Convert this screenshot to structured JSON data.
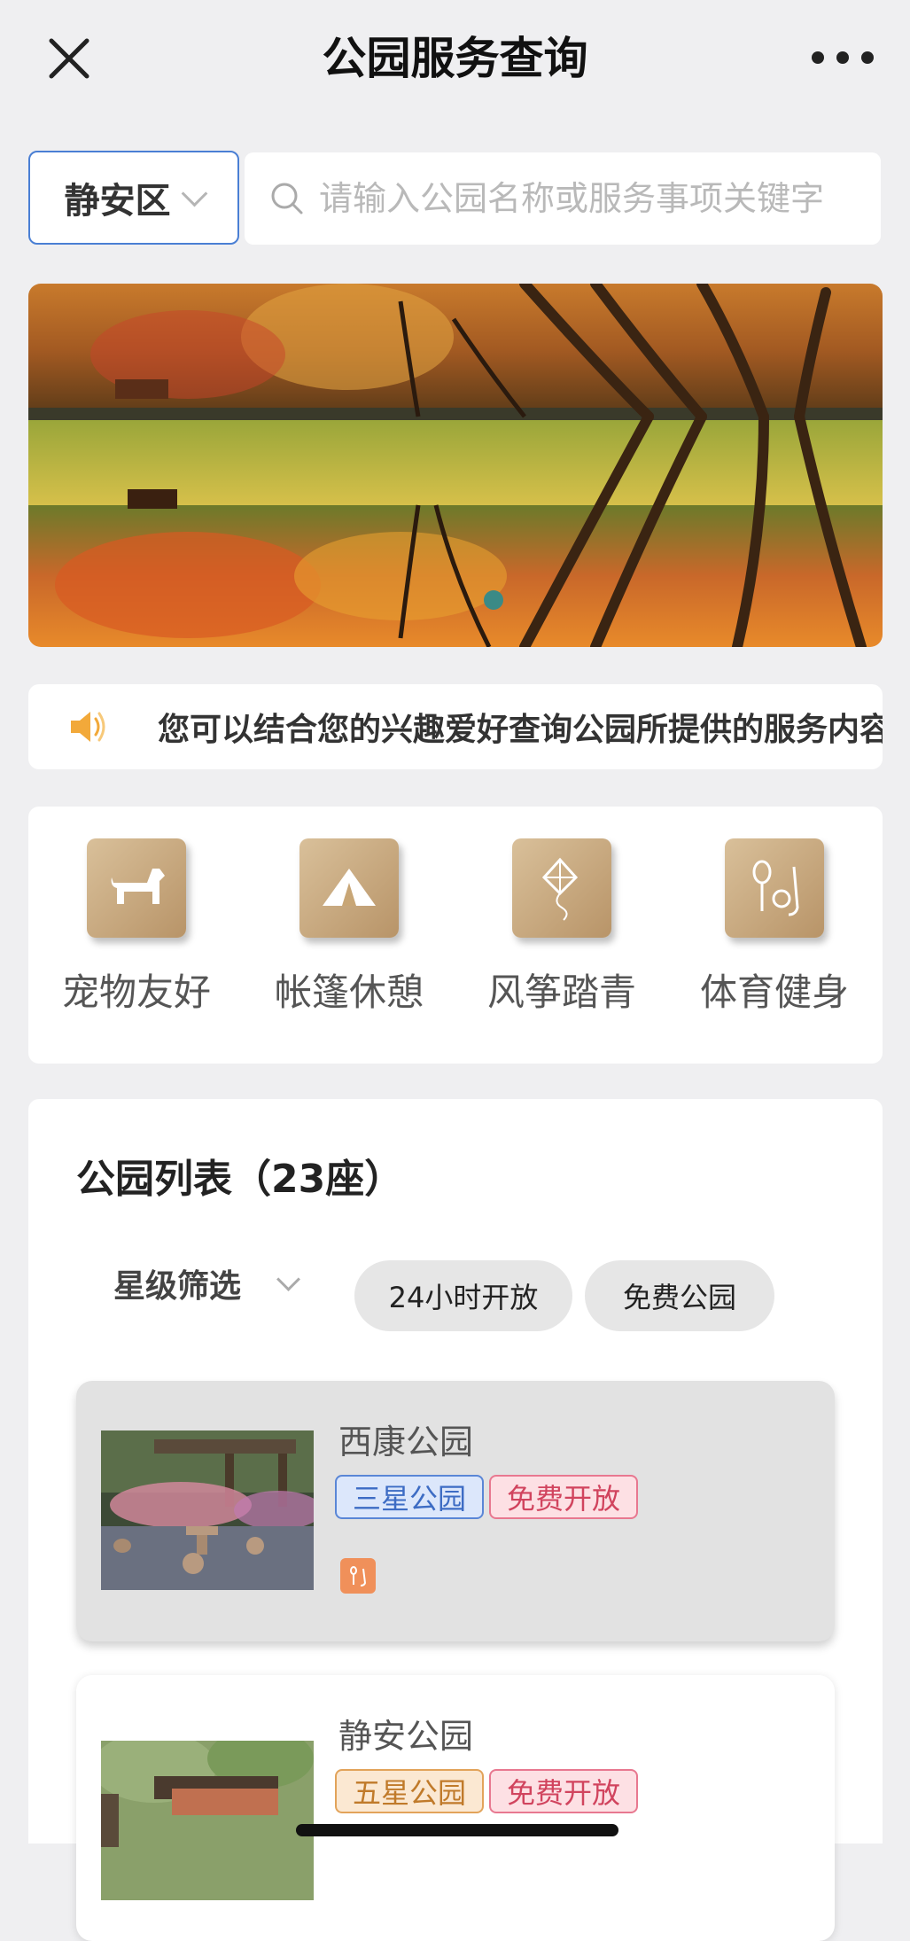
{
  "header": {
    "title": "公园服务查询",
    "close_icon": "close-icon",
    "more_icon": "more-icon"
  },
  "search": {
    "district": "静安区",
    "placeholder": "请输入公园名称或服务事项关键字"
  },
  "banner": {
    "slide_count": 1,
    "active_index": 0
  },
  "notice": {
    "text": "您可以结合您的兴趣爱好查询公园所提供的服务内容",
    "icon": "speaker-icon"
  },
  "services": [
    {
      "label": "宠物友好",
      "icon": "dog-icon"
    },
    {
      "label": "帐篷休憩",
      "icon": "tent-icon"
    },
    {
      "label": "风筝踏青",
      "icon": "kite-icon"
    },
    {
      "label": "体育健身",
      "icon": "sports-icon"
    }
  ],
  "park_list": {
    "title": "公园列表（23座）",
    "filters": {
      "star_label": "星级筛选",
      "chip_24h": "24小时开放",
      "chip_free": "免费公园"
    },
    "parks": [
      {
        "name": "西康公园",
        "star_tag": "三星公园",
        "fee_tag": "免费开放",
        "service_icon": "sports-icon"
      },
      {
        "name": "静安公园",
        "star_tag": "五星公园",
        "fee_tag": "免费开放"
      }
    ]
  },
  "colors": {
    "accent_blue": "#4a7fd4",
    "service_gold": "#c9a878",
    "tag_red": "#d1445e",
    "tag_orange": "#c07a2a"
  }
}
